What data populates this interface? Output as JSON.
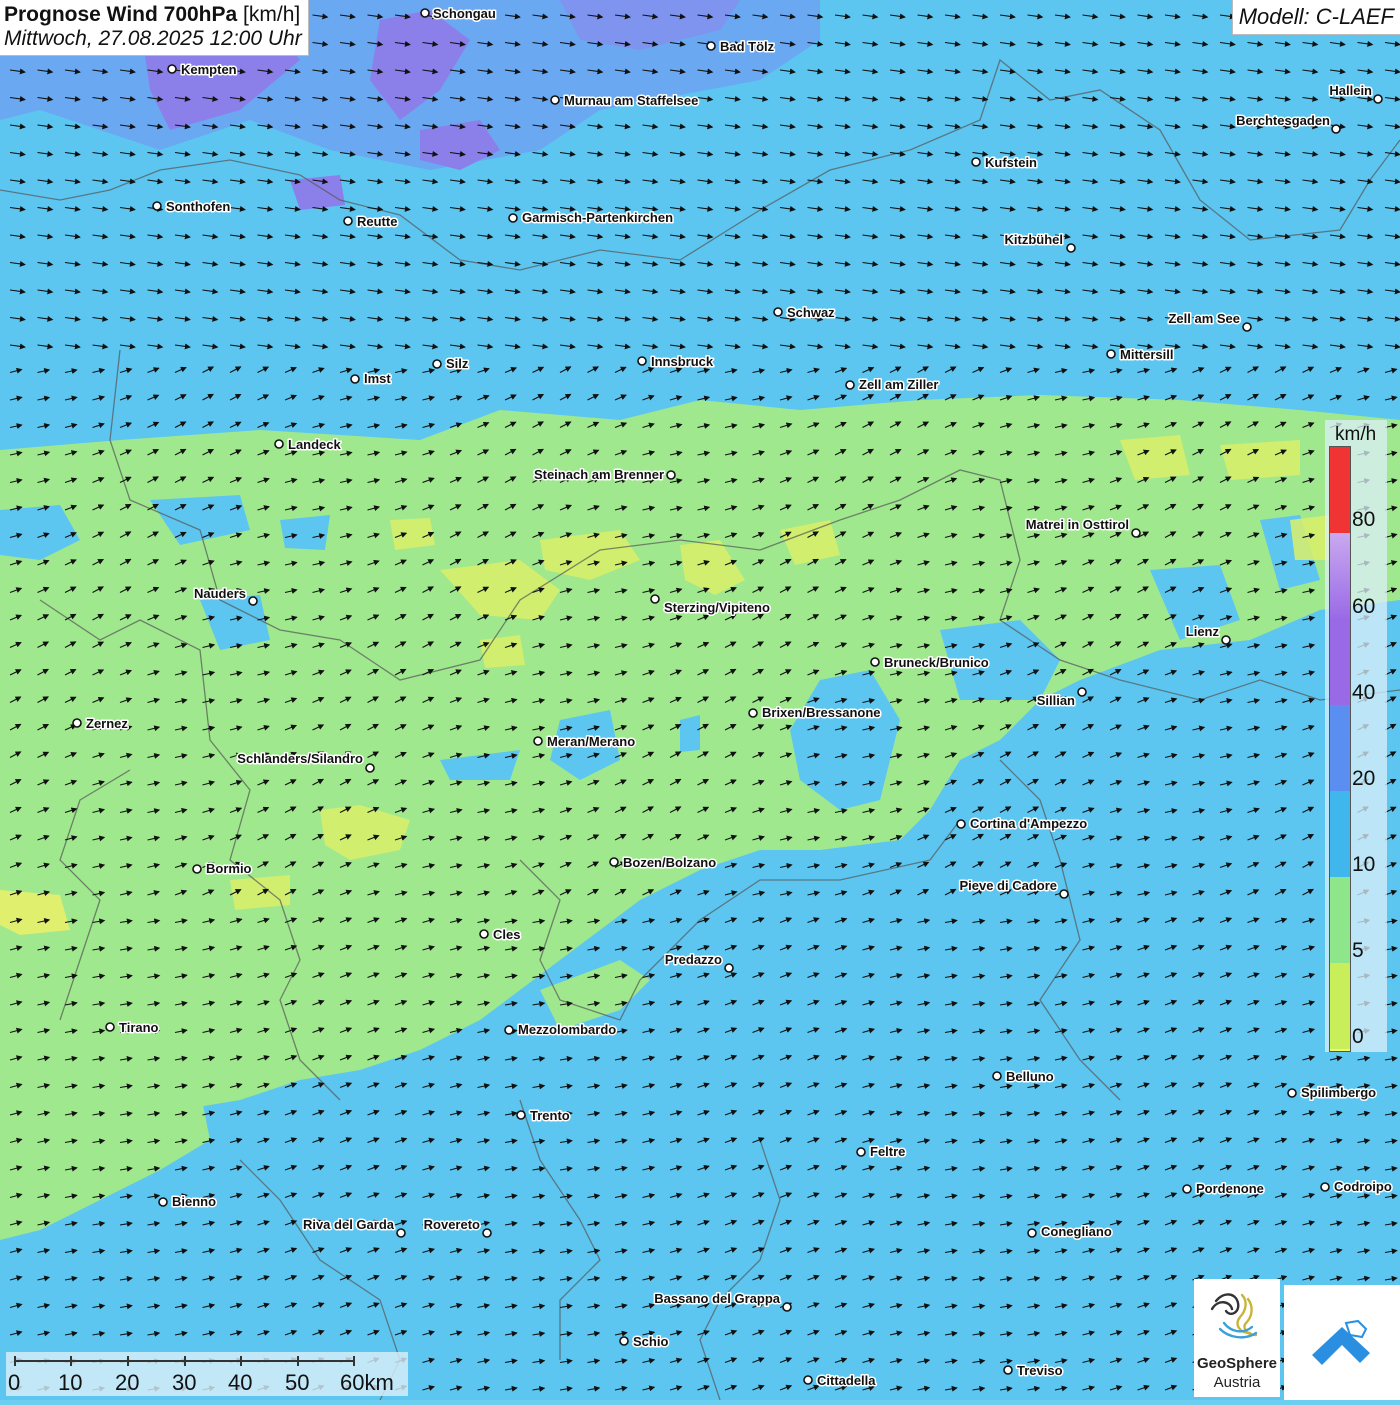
{
  "title": {
    "main": "Prognose Wind 700hPa",
    "unit": "[km/h]",
    "datetime": "Mittwoch, 27.08.2025 12:00 Uhr"
  },
  "model": "Modell: C-LAEF",
  "legend": {
    "unit": "km/h",
    "ticks": [
      "80",
      "60",
      "40",
      "20",
      "10",
      "5",
      "0"
    ],
    "colors": {
      "red": "#f03434",
      "lavender": "#c9a9f0",
      "purple": "#9a6ae6",
      "blue": "#5a8ef0",
      "skyblue": "#3fb6ec",
      "green": "#8ee68a",
      "yellowgreen": "#c8ee5a",
      "yellow": "#f6f46a"
    }
  },
  "scale": {
    "labels": [
      "0",
      "10",
      "20",
      "30",
      "40",
      "50",
      "60km"
    ]
  },
  "cities": [
    {
      "name": "Schongau"
    },
    {
      "name": "Bad Tölz"
    },
    {
      "name": "Kempten"
    },
    {
      "name": "Murnau am Staffelsee"
    },
    {
      "name": "Hallein"
    },
    {
      "name": "Berchtesgaden"
    },
    {
      "name": "Kufstein"
    },
    {
      "name": "Sonthofen"
    },
    {
      "name": "Reutte"
    },
    {
      "name": "Garmisch-Partenkirchen"
    },
    {
      "name": "Kitzbühel"
    },
    {
      "name": "Schwaz"
    },
    {
      "name": "Zell am See"
    },
    {
      "name": "Mittersill"
    },
    {
      "name": "Innsbruck"
    },
    {
      "name": "Silz"
    },
    {
      "name": "Imst"
    },
    {
      "name": "Zell am Ziller"
    },
    {
      "name": "Landeck"
    },
    {
      "name": "Steinach am Brenner"
    },
    {
      "name": "Matrei in Osttirol"
    },
    {
      "name": "Nauders"
    },
    {
      "name": "Sterzing/Vipiteno"
    },
    {
      "name": "Lienz"
    },
    {
      "name": "Bruneck/Brunico"
    },
    {
      "name": "Sillian"
    },
    {
      "name": "Brixen/Bressanone"
    },
    {
      "name": "Zernez"
    },
    {
      "name": "Meran/Merano"
    },
    {
      "name": "Schlanders/Silandro"
    },
    {
      "name": "Cortina d'Ampezzo"
    },
    {
      "name": "Bozen/Bolzano"
    },
    {
      "name": "Bormio"
    },
    {
      "name": "Pieve di Cadore"
    },
    {
      "name": "Cles"
    },
    {
      "name": "Predazzo"
    },
    {
      "name": "Tirano"
    },
    {
      "name": "Mezzolombardo"
    },
    {
      "name": "Belluno"
    },
    {
      "name": "Spilimbergo"
    },
    {
      "name": "Trento"
    },
    {
      "name": "Feltre"
    },
    {
      "name": "Pordenone"
    },
    {
      "name": "Codroipo"
    },
    {
      "name": "Bienno"
    },
    {
      "name": "Riva del Garda"
    },
    {
      "name": "Rovereto"
    },
    {
      "name": "Conegliano"
    },
    {
      "name": "Bassano del Grappa"
    },
    {
      "name": "Schio"
    },
    {
      "name": "Treviso"
    },
    {
      "name": "Cittadella"
    }
  ],
  "logos": {
    "geosphere_line1": "GeoSphere",
    "geosphere_line2": "Austria"
  }
}
